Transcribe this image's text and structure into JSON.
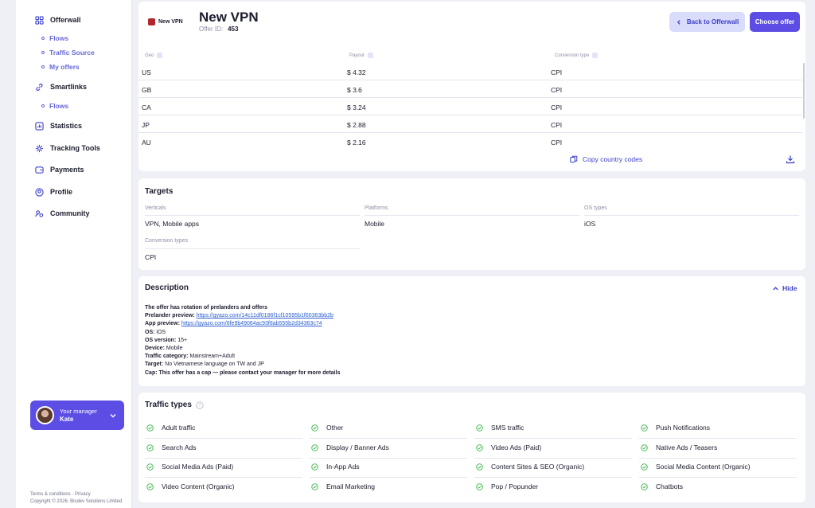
{
  "sidebar": {
    "offerwall": "Offerwall",
    "offerwall_subs": [
      "Flows",
      "Traffic Source",
      "My offers"
    ],
    "smartlinks": "Smartlinks",
    "smartlinks_subs": [
      "Flows"
    ],
    "items": [
      "Statistics",
      "Tracking Tools",
      "Payments",
      "Profile",
      "Community"
    ]
  },
  "manager": {
    "title": "Your manager",
    "name": "Kate"
  },
  "footer": {
    "terms": "Terms & conditions",
    "privacy": "Privacy",
    "copyright": "Copyright © 2026. Bisdev Solutions Limited"
  },
  "offer": {
    "logo_text": "New VPN",
    "name": "New VPN",
    "offer_id_label": "Offer ID:",
    "offer_id": "453",
    "back_label": "Back to Offerwall",
    "choose_label": "Choose offer"
  },
  "geo_table": {
    "headers": [
      "Geo",
      "Payout",
      "Conversion type"
    ],
    "rows": [
      [
        "US",
        "$ 4.32",
        "CPI"
      ],
      [
        "GB",
        "$ 3.6",
        "CPI"
      ],
      [
        "CA",
        "$ 3.24",
        "CPI"
      ],
      [
        "JP",
        "$ 2.88",
        "CPI"
      ],
      [
        "AU",
        "$ 2.16",
        "CPI"
      ]
    ],
    "copy_label": "Copy country codes"
  },
  "targets": {
    "title": "Targets",
    "verticals_label": "Verticals",
    "verticals": "VPN, Mobile apps",
    "platforms_label": "Platforms",
    "platforms": "Mobile",
    "os_label": "OS types",
    "os": "iOS",
    "conv_label": "Conversion types",
    "conv": "CPI"
  },
  "description": {
    "title": "Description",
    "hide_label": "Hide",
    "lines": [
      {
        "b": "The offer has rotation of prelanders and offers",
        "t": "",
        "link": ""
      },
      {
        "b": "Prelander preview: ",
        "t": "",
        "link": "https://gyazo.com/14c11df0186f1cf10595b1f60363bb2b"
      },
      {
        "b": "App preview: ",
        "t": "",
        "link": "https://gyazo.com/6fe9b49064ac93f8ab555b2d34363c74"
      },
      {
        "b": "OS: ",
        "t": "iOS",
        "link": ""
      },
      {
        "b": "OS version: ",
        "t": "15+",
        "link": ""
      },
      {
        "b": "Device: ",
        "t": "Mobile",
        "link": ""
      },
      {
        "b": "Traffic category: ",
        "t": "Mainstream+Adult",
        "link": ""
      },
      {
        "b": "Target: ",
        "t": "No Vietnamese language on TW and JP",
        "link": ""
      },
      {
        "b": "Cap: This offer has a cap — please contact your manager for more details",
        "t": "",
        "link": ""
      }
    ]
  },
  "traffic": {
    "title": "Traffic types",
    "items": [
      "Adult traffic",
      "Other",
      "SMS traffic",
      "Push Notifications",
      "Search Ads",
      "Display / Banner Ads",
      "Video Ads (Paid)",
      "Native Ads / Teasers",
      "Social Media Ads (Paid)",
      "In-App Ads",
      "Content Sites & SEO (Organic)",
      "Social Media Content (Organic)",
      "Video Content (Organic)",
      "Email Marketing",
      "Pop / Popunder",
      "Chatbots"
    ]
  },
  "colors": {
    "accent": "#5c4ee5",
    "check": "#3bb54a",
    "link": "#2a5fcf"
  }
}
